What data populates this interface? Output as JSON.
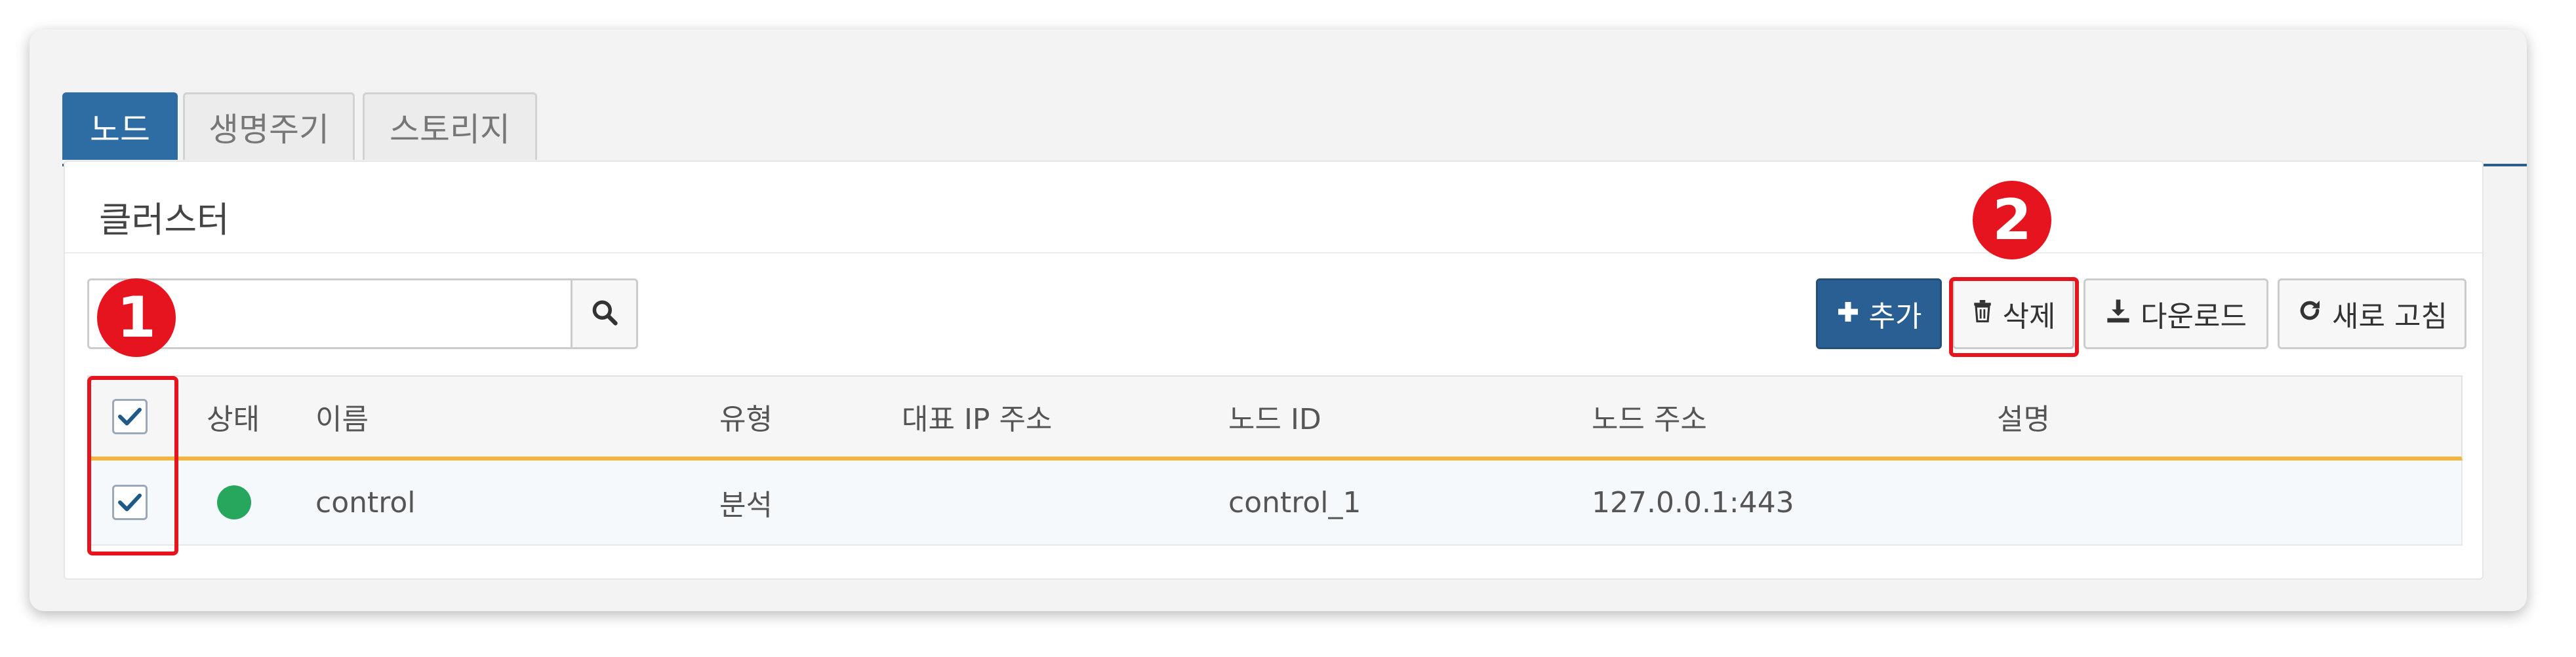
{
  "tabs": [
    {
      "label": "노드",
      "active": true
    },
    {
      "label": "생명주기",
      "active": false
    },
    {
      "label": "스토리지",
      "active": false
    }
  ],
  "panel": {
    "title": "클러스터"
  },
  "search": {
    "value": "",
    "placeholder": ""
  },
  "toolbar": {
    "add_label": "추가",
    "delete_label": "삭제",
    "download_label": "다운로드",
    "refresh_label": "새로 고침"
  },
  "table": {
    "columns": [
      "상태",
      "이름",
      "유형",
      "대표 IP 주소",
      "노드 ID",
      "노드 주소",
      "설명"
    ],
    "rows": [
      {
        "selected": true,
        "status": "online",
        "name": "control",
        "type": "분석",
        "ip": "",
        "node_id": "control_1",
        "address": "127.0.0.1:443",
        "description": ""
      }
    ]
  },
  "annotations": {
    "step1": "1",
    "step2": "2"
  },
  "colors": {
    "primary": "#2a5f94",
    "accent": "#f3b43b",
    "status_ok": "#27a75d",
    "annotation": "#e6141e"
  }
}
